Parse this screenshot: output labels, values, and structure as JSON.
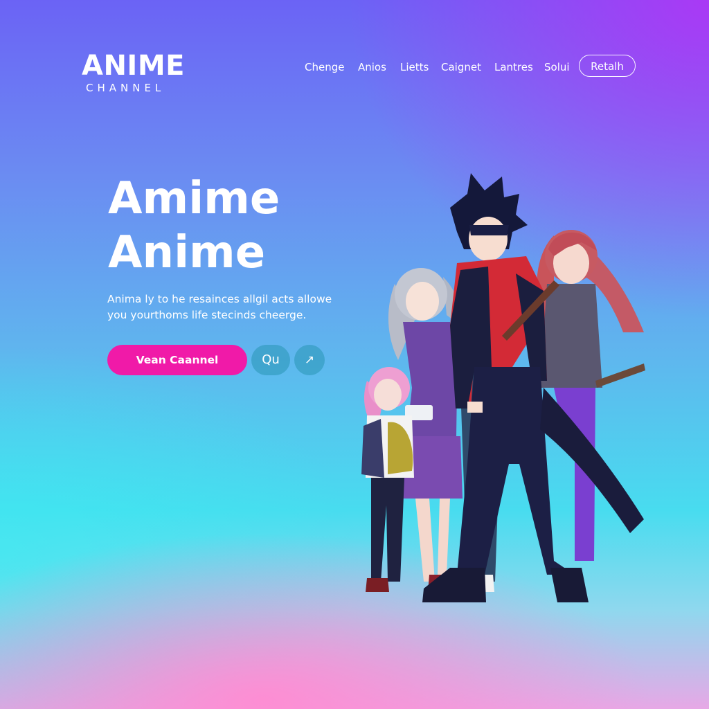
{
  "brand": {
    "name": "ANIME",
    "tagline": "CHANNEL"
  },
  "nav": {
    "links": [
      "Chenge",
      "Anios",
      "Lietts",
      "Caignet",
      "Lantres",
      "Solui"
    ],
    "button_label": "Retalh"
  },
  "hero": {
    "title_line1": "Amime",
    "title_line2": "Anime",
    "description_line1": "Anima ly to he resainces allgil acts allowe",
    "description_line2": "you yourthoms life stecinds cheerge.",
    "cta_label": "Vean Caannel",
    "secondary_label": "Qu",
    "arrow_icon": "↗"
  },
  "illustration": {
    "subject": "anime characters group illustration"
  },
  "colors": {
    "accent_pink": "#f01aa8",
    "gradient_top": "#6b63f5",
    "gradient_mid": "#48dcef",
    "gradient_bottom": "#e7a8e6",
    "corner_purple": "#b432f5"
  }
}
